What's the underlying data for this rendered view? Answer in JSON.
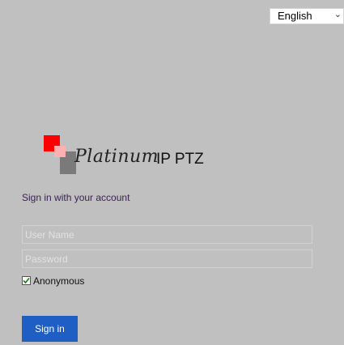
{
  "language": {
    "selected": "English"
  },
  "brand": {
    "script": "Platinum",
    "product": "IP PTZ"
  },
  "login": {
    "heading": "Sign in with your account",
    "username_placeholder": "User Name",
    "password_placeholder": "Password",
    "anonymous_label": "Anonymous",
    "anonymous_checked": true,
    "signin_label": "Sign in"
  },
  "colors": {
    "background": "#c0c0c0",
    "button": "#1f5fc4",
    "logo_red": "#ff0000",
    "logo_pink": "#ffb0b0",
    "logo_gray": "#7a7a7a"
  }
}
